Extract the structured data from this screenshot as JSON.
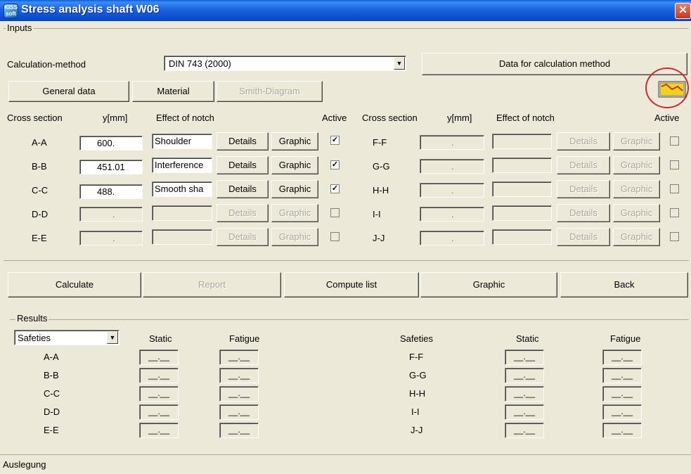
{
  "window": {
    "title": "Stress analysis shaft W06",
    "close": "✕"
  },
  "inputs": {
    "group_label": "Inputs",
    "method_label": "Calculation-method",
    "method_value": "DIN 743 (2000)",
    "data_button": "Data for calculation method",
    "general_button": "General data",
    "material_button": "Material",
    "smith_button": "Smith-Diagram",
    "headers": {
      "cross": "Cross section",
      "y": "y[mm]",
      "notch": "Effect of notch",
      "active": "Active"
    },
    "details_label": "Details",
    "graphic_label": "Graphic",
    "left": [
      {
        "name": "A-A",
        "y": "600.",
        "notch": "Shoulder",
        "active": true,
        "enabled": true
      },
      {
        "name": "B-B",
        "y": "451.01",
        "notch": "Interference",
        "active": true,
        "enabled": true
      },
      {
        "name": "C-C",
        "y": "488.",
        "notch": "Smooth sha",
        "active": true,
        "enabled": true
      },
      {
        "name": "D-D",
        "y": ".",
        "notch": "",
        "active": false,
        "enabled": false
      },
      {
        "name": "E-E",
        "y": ".",
        "notch": "",
        "active": false,
        "enabled": false
      }
    ],
    "right": [
      {
        "name": "F-F",
        "y": ".",
        "notch": ""
      },
      {
        "name": "G-G",
        "y": ".",
        "notch": ""
      },
      {
        "name": "H-H",
        "y": ".",
        "notch": ""
      },
      {
        "name": "I-I",
        "y": ".",
        "notch": ""
      },
      {
        "name": "J-J",
        "y": ".",
        "notch": ""
      }
    ]
  },
  "actions": {
    "calculate": "Calculate",
    "report": "Report",
    "compute_list": "Compute list",
    "graphic": "Graphic",
    "back": "Back"
  },
  "results": {
    "group_label": "Results",
    "select_value": "Safeties",
    "right_header": "Safeties",
    "static": "Static",
    "fatigue": "Fatigue",
    "empty_value": "__.__",
    "left_rows": [
      "A-A",
      "B-B",
      "C-C",
      "D-D",
      "E-E"
    ],
    "right_rows": [
      "F-F",
      "G-G",
      "H-H",
      "I-I",
      "J-J"
    ]
  },
  "status_text": "Auslegung"
}
